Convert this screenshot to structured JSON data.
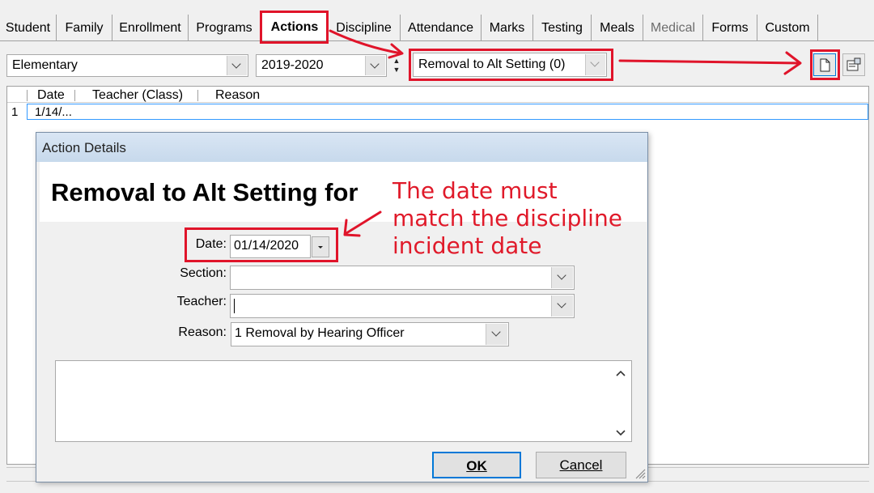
{
  "tabs": [
    {
      "label": "Student",
      "state": "normal"
    },
    {
      "label": "Family",
      "state": "normal"
    },
    {
      "label": "Enrollment",
      "state": "normal"
    },
    {
      "label": "Programs",
      "state": "normal"
    },
    {
      "label": "Actions",
      "state": "active"
    },
    {
      "label": "Discipline",
      "state": "normal"
    },
    {
      "label": "Attendance",
      "state": "normal"
    },
    {
      "label": "Marks",
      "state": "normal"
    },
    {
      "label": "Testing",
      "state": "normal"
    },
    {
      "label": "Meals",
      "state": "normal"
    },
    {
      "label": "Medical",
      "state": "disabled"
    },
    {
      "label": "Forms",
      "state": "normal"
    },
    {
      "label": "Custom",
      "state": "normal"
    }
  ],
  "toolbar": {
    "school": "Elementary",
    "year": "2019-2020",
    "action_type": "Removal to Alt Setting (0)"
  },
  "grid": {
    "columns": [
      "Date",
      "Teacher (Class)",
      "Reason"
    ],
    "rows": [
      {
        "num": "1",
        "date": "1/14/..."
      }
    ]
  },
  "dialog": {
    "title": "Action Details",
    "heading": "Removal to Alt Setting for",
    "date_label": "Date:",
    "date_value": "01/14/2020",
    "section_label": "Section:",
    "section_value": "",
    "teacher_label": "Teacher:",
    "teacher_value": "",
    "reason_label": "Reason:",
    "reason_value": "1 Removal by Hearing Officer",
    "notes": "",
    "ok_label": "OK",
    "cancel_label": "Cancel"
  },
  "annotation": {
    "note_lines": [
      "The date must",
      "match the discipline",
      "incident date"
    ],
    "color": "#e0142a"
  }
}
